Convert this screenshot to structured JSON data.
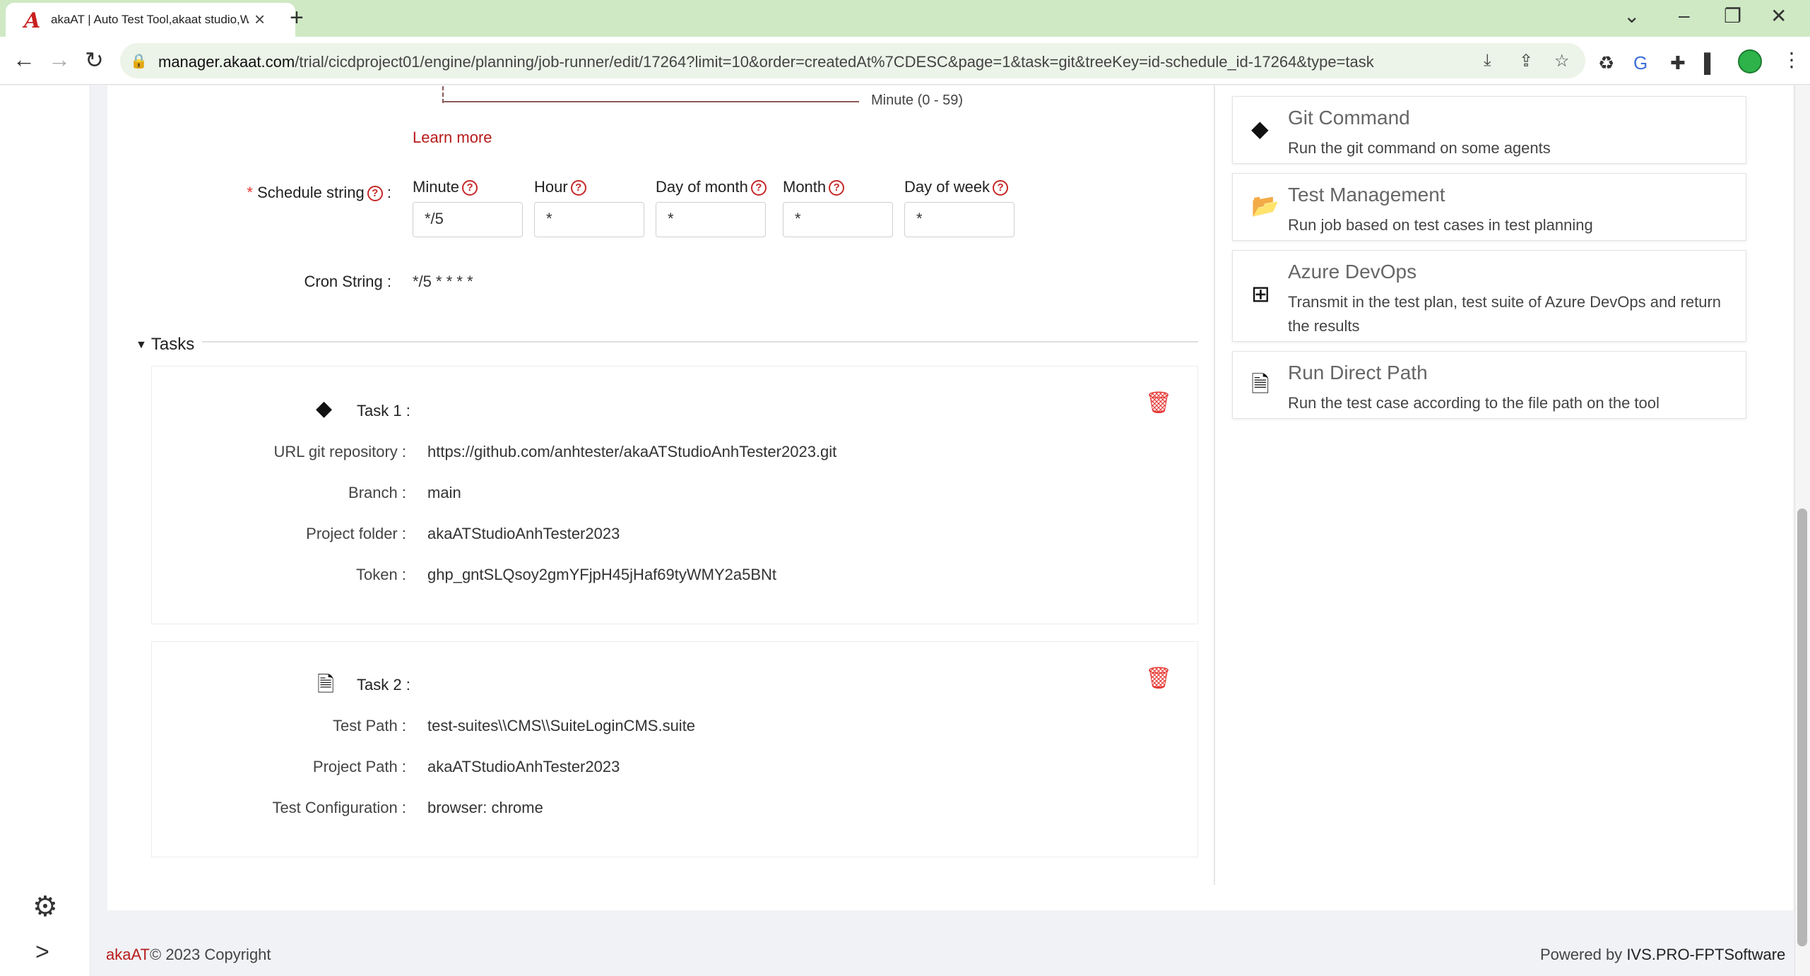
{
  "browser": {
    "tab_title": "akaAT | Auto Test Tool,akaat studio,Web",
    "url_host": "manager.akaat.com",
    "url_path": "/trial/cicdproject01/engine/planning/job-runner/edit/17264?limit=10&order=createdAt%7CDESC&page=1&task=git&treeKey=id-schedule_id-17264&type=task"
  },
  "cron_diagram": {
    "axis_label": "Minute (0 - 59)"
  },
  "learn_more": "Learn more",
  "schedule": {
    "label": "Schedule string",
    "columns": [
      {
        "label": "Minute",
        "value": "*/5"
      },
      {
        "label": "Hour",
        "value": "*"
      },
      {
        "label": "Day of month",
        "value": "*"
      },
      {
        "label": "Month",
        "value": "*"
      },
      {
        "label": "Day of week",
        "value": "*"
      }
    ]
  },
  "cron": {
    "label": "Cron String",
    "value": "*/5 * * * *"
  },
  "tasks": {
    "header": "Tasks",
    "items": [
      {
        "title": "Task 1",
        "icon": "git-icon",
        "fields": [
          {
            "key": "URL git repository",
            "value": "https://github.com/anhtester/akaATStudioAnhTester2023.git"
          },
          {
            "key": "Branch",
            "value": "main"
          },
          {
            "key": "Project folder",
            "value": "akaATStudioAnhTester2023"
          },
          {
            "key": "Token",
            "value": "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"
          }
        ]
      },
      {
        "title": "Task 2",
        "icon": "file-code-icon",
        "fields": [
          {
            "key": "Test Path",
            "value": "test-suites\\\\CMS\\\\SuiteLoginCMS.suite"
          },
          {
            "key": "Project Path",
            "value": "akaATStudioAnhTester2023"
          },
          {
            "key": "Test Configuration",
            "value": "browser: chrome"
          }
        ]
      }
    ]
  },
  "commands": [
    {
      "title": "Git Command",
      "desc": "Run the git command on some agents",
      "icon": "git-icon"
    },
    {
      "title": "Test Management",
      "desc": "Run job based on test cases in test planning",
      "icon": "folder-open-icon"
    },
    {
      "title": "Azure DevOps",
      "desc": "Transmit in the test plan, test suite of Azure DevOps and return the results",
      "icon": "windows-icon"
    },
    {
      "title": "Run Direct Path",
      "desc": "Run the test case according to the file path on the tool",
      "icon": "file-code-icon"
    }
  ],
  "footer": {
    "brand": "akaAT",
    "copyright": "© 2023 Copyright",
    "powered_prefix": "Powered by",
    "powered_by": "IVS.PRO-FPTSoftware"
  },
  "colors": {
    "accent": "#b71c1c",
    "danger": "#e53935",
    "chrome": "#cfe9c4"
  }
}
